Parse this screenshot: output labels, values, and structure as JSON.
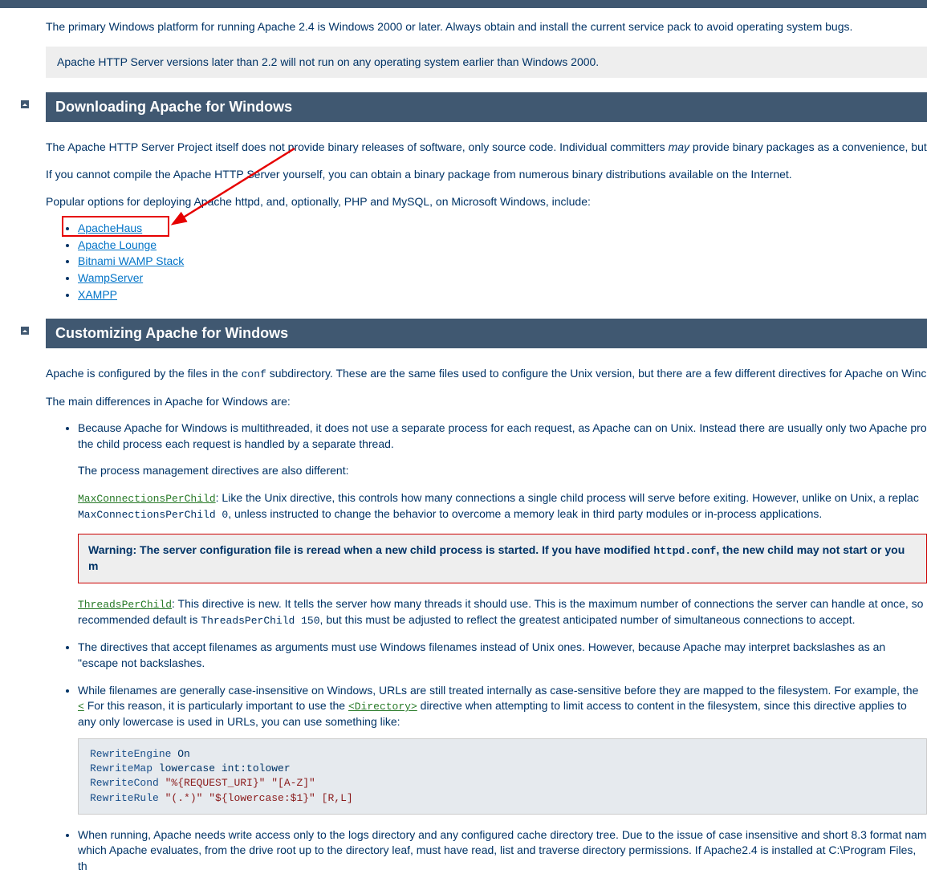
{
  "intro": {
    "primary_platform": "The primary Windows platform for running Apache 2.4 is Windows 2000 or later. Always obtain and install the current service pack to avoid operating system bugs.",
    "note_text": "Apache HTTP Server versions later than 2.2 will not run on any operating system earlier than Windows 2000."
  },
  "download": {
    "heading": "Downloading Apache for Windows",
    "p1a": "The Apache HTTP Server Project itself does not provide binary releases of software, only source code. Individual committers ",
    "p1_may": "may",
    "p1b": " provide binary packages as a convenience, but",
    "p2": "If you cannot compile the Apache HTTP Server yourself, you can obtain a binary package from numerous binary distributions available on the Internet.",
    "p3": "Popular options for deploying Apache httpd, and, optionally, PHP and MySQL, on Microsoft Windows, include:",
    "links": [
      "ApacheHaus",
      "Apache Lounge",
      "Bitnami WAMP Stack",
      "WampServer",
      "XAMPP"
    ]
  },
  "customize": {
    "heading": "Customizing Apache for Windows",
    "p1a": "Apache is configured by the files in the ",
    "p1_code": "conf",
    "p1b": " subdirectory. These are the same files used to configure the Unix version, but there are a few different directives for Apache on Winc",
    "p2": "The main differences in Apache for Windows are:",
    "b1a": "Because Apache for Windows is multithreaded, it does not use a separate process for each request, as Apache can on Unix. Instead there are usually only two Apache pro the child process each request is handled by a separate thread.",
    "b1b": "The process management directives are also different:",
    "mcpc_link": "MaxConnectionsPerChild",
    "mcpc_text_a": ": Like the Unix directive, this controls how many connections a single child process will serve before exiting. However, unlike on Unix, a replac ",
    "mcpc_code": "MaxConnectionsPerChild 0",
    "mcpc_text_b": ", unless instructed to change the behavior to overcome a memory leak in third party modules or in-process applications.",
    "warn_a": "Warning: The server configuration file is reread when a new child process is started. If you have modified ",
    "warn_code": "httpd.conf",
    "warn_b": ", the new child may not start or you m",
    "tpc_link": "ThreadsPerChild",
    "tpc_text_a": ": This directive is new. It tells the server how many threads it should use. This is the maximum number of connections the server can handle at once, so recommended default is ",
    "tpc_code": "ThreadsPerChild 150",
    "tpc_text_b": ", but this must be adjusted to reflect the greatest anticipated number of simultaneous connections to accept.",
    "b2": "The directives that accept filenames as arguments must use Windows filenames instead of Unix ones. However, because Apache may interpret backslashes as an \"escape not backslashes.",
    "b3a": "While filenames are generally case-insensitive on Windows, URLs are still treated internally as case-sensitive before they are mapped to the filesystem. For example, the ",
    "b3_link1": "<",
    "b3b": " For this reason, it is particularly important to use the ",
    "b3_link2": "<Directory>",
    "b3c": " directive when attempting to limit access to content in the filesystem, since this directive applies to any only lowercase is used in URLs, you can use something like:",
    "code_lines": [
      {
        "kw": "RewriteEngine",
        "rest": " On"
      },
      {
        "kw": "RewriteMap",
        "rest": " lowercase int:tolower"
      },
      {
        "kw": "RewriteCond",
        "str": " \"%{REQUEST_URI}\" \"[A-Z]\""
      },
      {
        "kw": "RewriteRule",
        "str": " \"(.*)\" \"${lowercase:$1}\" [R,L]"
      }
    ],
    "b4": "When running, Apache needs write access only to the logs directory and any configured cache directory tree. Due to the issue of case insensitive and short 8.3 format nam which Apache evaluates, from the drive root up to the directory leaf, must have read, list and traverse directory permissions. If Apache2.4 is installed at C:\\Program Files, th"
  }
}
